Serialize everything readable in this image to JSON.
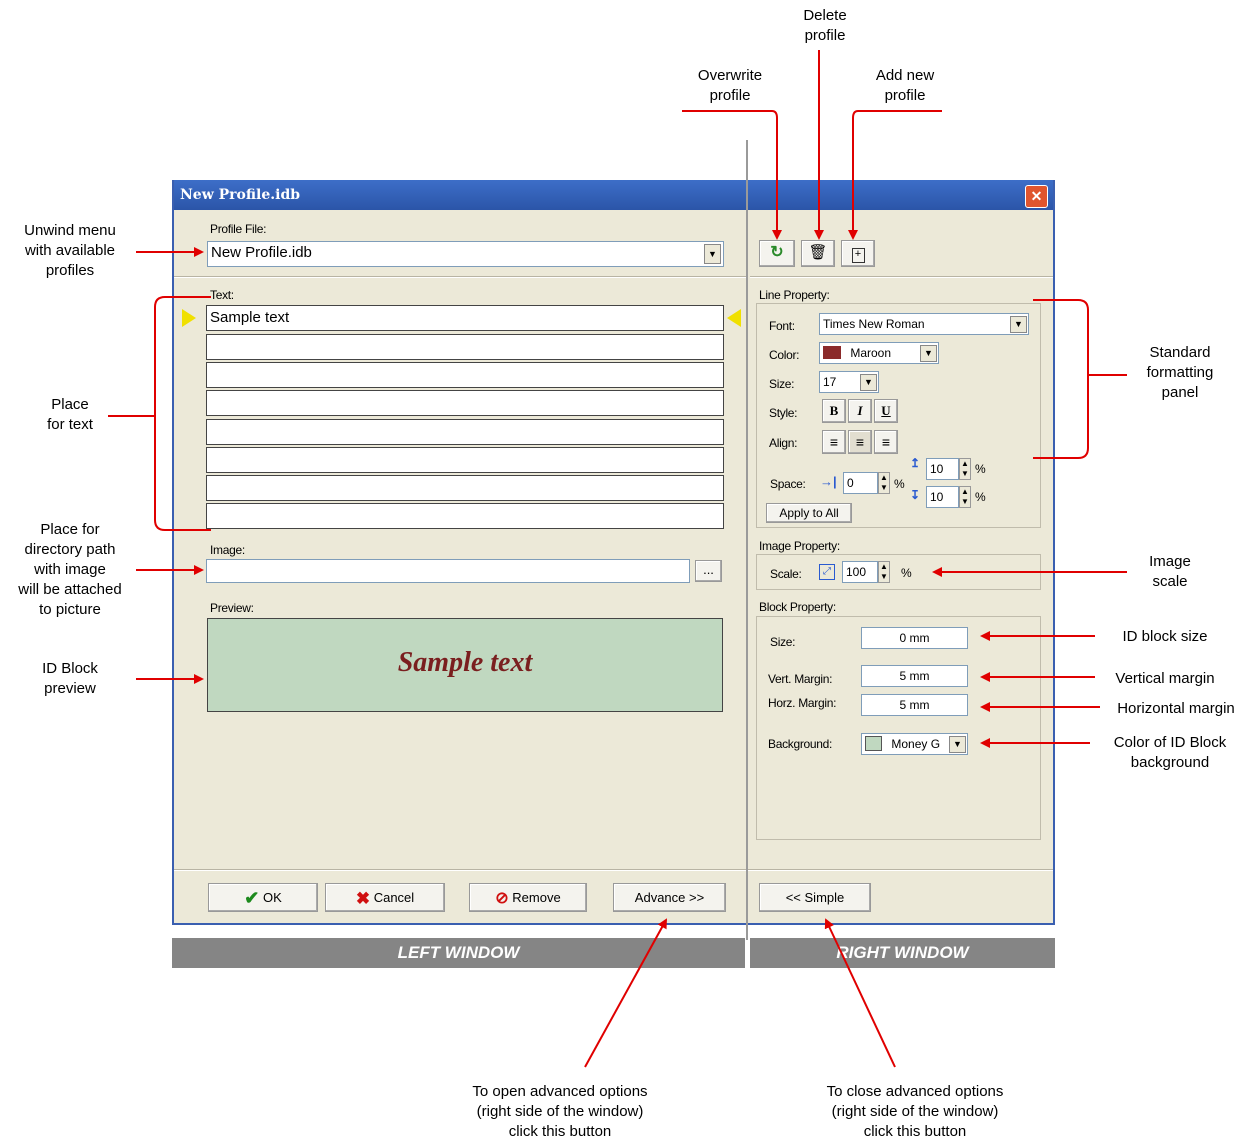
{
  "annotations": {
    "delete_profile": "Delete\nprofile",
    "overwrite_profile": "Overwrite\nprofile",
    "add_new_profile": "Add new\nprofile",
    "unwind_menu": "Unwind menu\nwith available\nprofiles",
    "place_for_text": "Place\nfor text",
    "place_for_path": "Place for\ndirectory path\nwith image\nwill be attached\nto picture",
    "id_block_preview": "ID Block\npreview",
    "standard_formatting": "Standard\nformatting\npanel",
    "image_scale": "Image\nscale",
    "id_block_size": "ID block size",
    "vertical_margin": "Vertical margin",
    "horizontal_margin": "Horizontal margin",
    "color_background": "Color of ID Block\nbackground",
    "open_advanced": "To open advanced options\n(right side of the window)\nclick this button",
    "close_advanced": "To close advanced options\n(right side of the window)\nclick this button"
  },
  "window": {
    "title": "New Profile.idb",
    "close_glyph": "✕"
  },
  "left": {
    "profile_file_label": "Profile File:",
    "profile_file_value": "New Profile.idb",
    "text_label": "Text:",
    "text_lines": [
      "Sample text",
      "",
      "",
      "",
      "",
      "",
      "",
      ""
    ],
    "image_label": "Image:",
    "image_value": "",
    "browse_label": "...",
    "preview_label": "Preview:",
    "preview_text": "Sample text",
    "preview_bg": "#c0d8c0",
    "preview_color": "#7a1f1f"
  },
  "buttons": {
    "ok": "OK",
    "cancel": "Cancel",
    "remove": "Remove",
    "advance": "Advance >>",
    "simple": "<< Simple"
  },
  "right": {
    "line_property_label": "Line Property:",
    "font_label": "Font:",
    "font_value": "Times New Roman",
    "color_label": "Color:",
    "color_value": "Maroon",
    "color_swatch": "#8b2a2a",
    "size_label": "Size:",
    "size_value": "17",
    "style_label": "Style:",
    "bold": "B",
    "italic": "I",
    "underline": "U",
    "align_label": "Align:",
    "space_label": "Space:",
    "space_indent": "0",
    "space_above": "10",
    "space_below": "10",
    "percent": "%",
    "apply_all": "Apply to All",
    "image_property_label": "Image Property:",
    "scale_label": "Scale:",
    "scale_value": "100",
    "block_property_label": "Block Property:",
    "block_size_label": "Size:",
    "block_size_value": "0 mm",
    "vert_margin_label": "Vert. Margin:",
    "vert_margin_value": "5 mm",
    "horz_margin_label": "Horz. Margin:",
    "horz_margin_value": "5 mm",
    "background_label": "Background:",
    "background_value": "Money G",
    "background_swatch": "#c0d8c0"
  },
  "bands": {
    "left": "LEFT WINDOW",
    "right": "RIGHT WINDOW"
  },
  "colors": {
    "arrow": "#e00000",
    "titlebar": "#2b55a8",
    "window_bg": "#ece9d8"
  }
}
